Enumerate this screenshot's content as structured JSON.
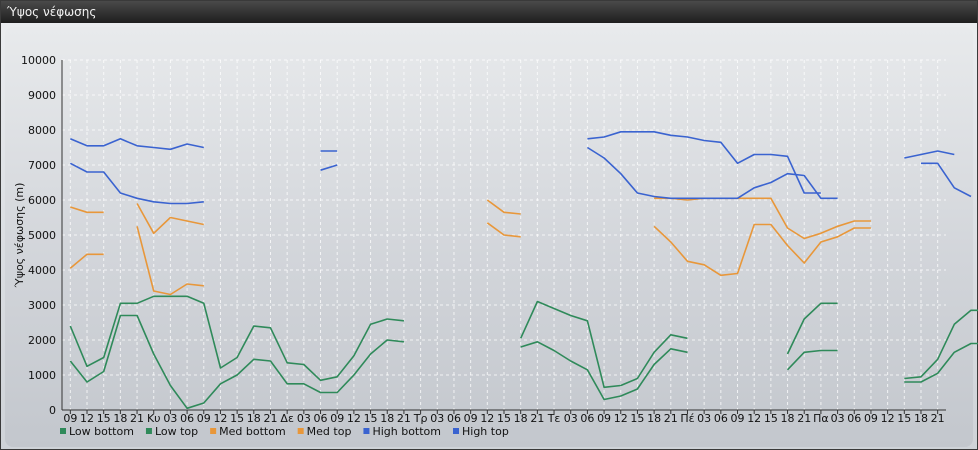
{
  "window": {
    "title": "Ύψος νέφωσης"
  },
  "chart_data": {
    "type": "line",
    "title": "",
    "xlabel": "",
    "ylabel": "Ύψος νέφωσης (m)",
    "ylim": [
      0,
      10000
    ],
    "yticks": [
      0,
      1000,
      2000,
      3000,
      4000,
      5000,
      6000,
      7000,
      8000,
      9000,
      10000
    ],
    "grid": true,
    "legend_position": "bottom-left",
    "x_tick_labels": [
      "09",
      "12",
      "15",
      "18",
      "21",
      "Κυ",
      "03",
      "06",
      "09",
      "12",
      "15",
      "18",
      "21",
      "Δε",
      "03",
      "06",
      "09",
      "12",
      "15",
      "18",
      "21",
      "Τρ",
      "03",
      "06",
      "09",
      "12",
      "15",
      "18",
      "21",
      "Τε",
      "03",
      "06",
      "09",
      "12",
      "15",
      "18",
      "21",
      "Πέ",
      "03",
      "06",
      "09",
      "12",
      "15",
      "18",
      "21",
      "Πα",
      "03",
      "06",
      "09",
      "12",
      "15",
      "18",
      "21"
    ],
    "colors": {
      "Low": "#2f8a5a",
      "Med": "#e8973a",
      "High": "#3a63d0"
    },
    "series": [
      {
        "name": "Low bottom",
        "values": [
          1400,
          800,
          1100,
          2700,
          2700,
          1600,
          700,
          50,
          200,
          750,
          1000,
          1450,
          1400,
          750,
          750,
          500,
          500,
          1000,
          1600,
          2000,
          1950,
          null,
          null,
          null,
          null,
          null,
          null,
          1800,
          1950,
          1700,
          1400,
          1150,
          300,
          400,
          600,
          1300,
          1750,
          1650,
          null,
          null,
          null,
          null,
          null,
          1150,
          1650,
          1700,
          1700,
          null,
          null,
          null,
          800,
          800,
          1050,
          1650,
          1900,
          1900
        ]
      },
      {
        "name": "Low top",
        "values": [
          2400,
          1250,
          1500,
          3050,
          3050,
          3250,
          3250,
          3250,
          3050,
          1200,
          1500,
          2400,
          2350,
          1350,
          1300,
          850,
          950,
          1550,
          2450,
          2600,
          2550,
          null,
          null,
          null,
          null,
          null,
          null,
          2050,
          3100,
          2900,
          2700,
          2550,
          650,
          700,
          900,
          1650,
          2150,
          2050,
          null,
          null,
          null,
          null,
          null,
          1600,
          2600,
          3050,
          3050,
          null,
          null,
          null,
          900,
          950,
          1450,
          2450,
          2850,
          2850
        ]
      },
      {
        "name": "Med bottom",
        "values": [
          4050,
          4450,
          4450,
          null,
          5250,
          3400,
          3300,
          3600,
          3550,
          null,
          null,
          null,
          null,
          null,
          null,
          null,
          null,
          null,
          null,
          null,
          null,
          null,
          null,
          null,
          null,
          5350,
          5000,
          4950,
          null,
          null,
          null,
          null,
          null,
          null,
          null,
          5250,
          4800,
          4250,
          4150,
          3850,
          3900,
          5300,
          5300,
          4700,
          4200,
          4800,
          4950,
          5200,
          5200,
          null,
          null,
          null,
          null,
          null,
          null,
          null
        ]
      },
      {
        "name": "Med top",
        "values": [
          5800,
          5650,
          5650,
          null,
          5900,
          5050,
          5500,
          5400,
          5300,
          null,
          null,
          null,
          null,
          null,
          null,
          null,
          null,
          null,
          null,
          null,
          null,
          null,
          null,
          null,
          null,
          6000,
          5650,
          5600,
          null,
          null,
          null,
          null,
          null,
          null,
          null,
          6050,
          6050,
          6000,
          6050,
          6050,
          6050,
          6050,
          6050,
          5200,
          4900,
          5050,
          5250,
          5400,
          5400,
          null,
          null,
          null,
          null,
          null,
          null,
          null
        ]
      },
      {
        "name": "High bottom",
        "values": [
          7050,
          6800,
          6800,
          6200,
          6050,
          5950,
          5900,
          5900,
          5950,
          null,
          null,
          null,
          null,
          null,
          null,
          6850,
          7000,
          null,
          null,
          null,
          null,
          null,
          null,
          null,
          null,
          null,
          null,
          null,
          null,
          null,
          null,
          7500,
          7200,
          6750,
          6200,
          6100,
          6050,
          6050,
          6050,
          6050,
          6050,
          6350,
          6500,
          6750,
          6700,
          6050,
          6050,
          null,
          null,
          null,
          null,
          7050,
          7050,
          6350,
          6100
        ]
      },
      {
        "name": "High top",
        "values": [
          7750,
          7550,
          7550,
          7750,
          7550,
          7500,
          7450,
          7600,
          7500,
          null,
          null,
          null,
          null,
          null,
          null,
          7400,
          7400,
          null,
          null,
          null,
          null,
          null,
          null,
          null,
          null,
          null,
          null,
          null,
          null,
          null,
          null,
          7750,
          7800,
          7950,
          7950,
          7950,
          7850,
          7800,
          7700,
          7650,
          7050,
          7300,
          7300,
          7250,
          6200,
          6200,
          null,
          null,
          null,
          null,
          7200,
          7300,
          7400,
          7300
        ]
      }
    ]
  }
}
